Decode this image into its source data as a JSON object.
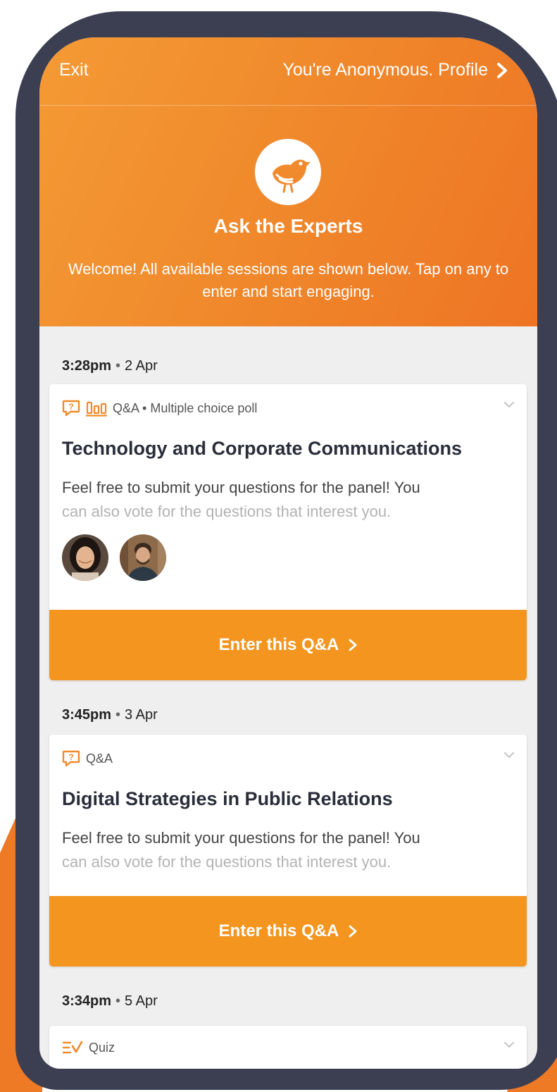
{
  "colors": {
    "accent": "#f3951f",
    "header_start": "#f49a35",
    "header_end": "#ee7424",
    "frame": "#3b3f51",
    "list_background": "#efefef"
  },
  "header": {
    "exit_label": "Exit",
    "profile_label": "You're Anonymous. Profile",
    "logo_icon": "bird-icon",
    "event_title": "Ask the Experts",
    "welcome_text": "Welcome! All available sessions are shown below. Tap on any to enter and start engaging."
  },
  "sessions": [
    {
      "time": "3:28pm",
      "date": "2 Apr",
      "type_icons": [
        "qa-bubble-icon",
        "poll-bars-icon"
      ],
      "type_label": "Q&A • Multiple choice poll",
      "title": "Technology and Corporate Communications",
      "description_visible": "Feel free to submit your questions for the panel! You",
      "description_faded": "can also vote for the questions that interest you.",
      "speakers": [
        "speaker-avatar-woman",
        "speaker-avatar-man"
      ],
      "button_label": "Enter this Q&A"
    },
    {
      "time": "3:45pm",
      "date": "3 Apr",
      "type_icons": [
        "qa-bubble-icon"
      ],
      "type_label": "Q&A",
      "title": "Digital Strategies in Public Relations",
      "description_visible": "Feel free to submit your questions for the panel! You",
      "description_faded": "can also vote for the questions that interest you.",
      "speakers": [],
      "button_label": "Enter this Q&A"
    },
    {
      "time": "3:34pm",
      "date": "5 Apr",
      "type_icons": [
        "quiz-icon"
      ],
      "type_label": "Quiz"
    }
  ]
}
